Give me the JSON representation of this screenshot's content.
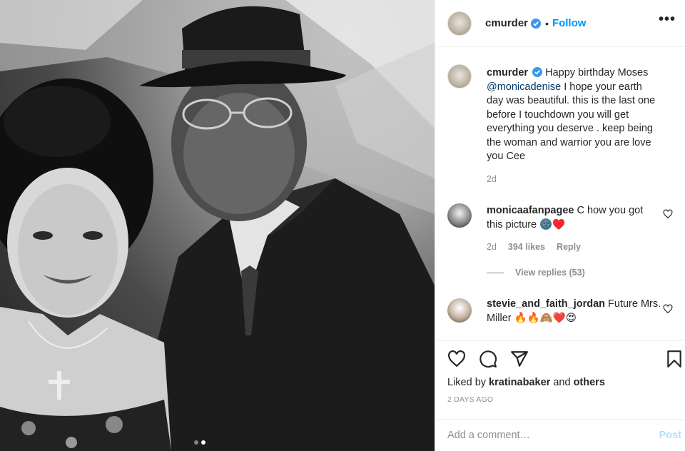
{
  "header": {
    "username": "cmurder",
    "separator": "•",
    "follow_label": "Follow",
    "more_label": "•••"
  },
  "caption": {
    "username": "cmurder",
    "text_before": "Happy birthday Moses",
    "mention": "@monicadenise",
    "text_after": "I hope your earth day was beautiful. this is the last one before I touchdown you will get everything you deserve . keep being the woman and warrior you are love you Cee",
    "time": "2d"
  },
  "comments": [
    {
      "username": "monicaafanpagee",
      "text": "C how you got this picture 🌚♥️",
      "time": "2d",
      "likes": "394 likes",
      "reply_label": "Reply",
      "view_replies": "View replies (53)"
    },
    {
      "username": "stevie_and_faith_jordan",
      "text": "Future Mrs. Miller 🔥🔥🙈❤️😍"
    }
  ],
  "likes": {
    "prefix": "Liked by",
    "user": "kratinabaker",
    "middle": "and",
    "others": "others"
  },
  "posted_ago": "2 DAYS AGO",
  "add_comment": {
    "placeholder": "Add a comment…",
    "post_label": "Post"
  },
  "colors": {
    "accent": "#0095f6",
    "post_disabled": "#b2dffc",
    "secondary_text": "#8e8e8e"
  },
  "icons": [
    "verified-badge-icon",
    "heart-icon",
    "comment-icon",
    "share-icon",
    "bookmark-icon"
  ],
  "carousel": {
    "count": 2,
    "active": 2
  }
}
